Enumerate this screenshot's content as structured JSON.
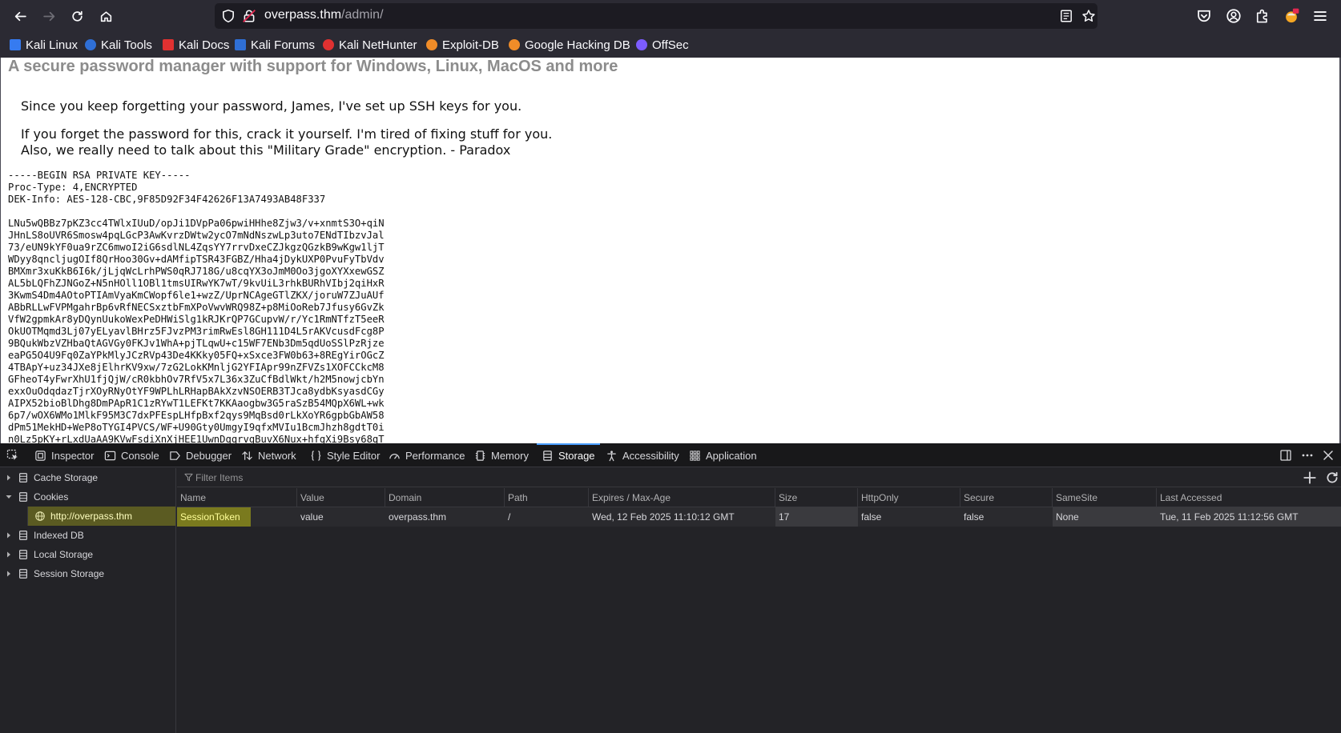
{
  "browser": {
    "url_host": "overpass.thm",
    "url_path": "/admin/"
  },
  "bookmarks": [
    {
      "label": "Kali Linux",
      "color": "#367bf0"
    },
    {
      "label": "Kali Tools",
      "color": "#2f6fd6"
    },
    {
      "label": "Kali Docs",
      "color": "#e03131"
    },
    {
      "label": "Kali Forums",
      "color": "#2f6fd6"
    },
    {
      "label": "Kali NetHunter",
      "color": "#e03131"
    },
    {
      "label": "Exploit-DB",
      "color": "#f08c28"
    },
    {
      "label": "Google Hacking DB",
      "color": "#f08c28"
    },
    {
      "label": "OffSec",
      "color": "#7c5cff"
    }
  ],
  "page": {
    "subtitle": "A secure password manager with support for Windows, Linux, MacOS and more",
    "msg1": "Since you keep forgetting your password, James, I've set up SSH keys for you.",
    "msg2": "If you forget the password for this, crack it yourself. I'm tired of fixing stuff for you.",
    "msg3": "Also, we really need to talk about this \"Military Grade\" encryption. - Paradox",
    "key_header": "-----BEGIN RSA PRIVATE KEY-----\nProc-Type: 4,ENCRYPTED\nDEK-Info: AES-128-CBC,9F85D92F34F42626F13A7493AB48F337",
    "key_body": "LNu5wQBBz7pKZ3cc4TWlxIUuD/opJi1DVpPa06pwiHHhe8Zjw3/v+xnmtS3O+qiN\nJHnLS8oUVR6Smosw4pqLGcP3AwKvrzDWtw2ycO7mNdNszwLp3uto7ENdTIbzvJal\n73/eUN9kYF0ua9rZC6mwoI2iG6sdlNL4ZqsYY7rrvDxeCZJkgzQGzkB9wKgw1ljT\nWDyy8qncljugOIf8QrHoo30Gv+dAMfipTSR43FGBZ/Hha4jDykUXP0PvuFyTbVdv\nBMXmr3xuKkB6I6k/jLjqWcLrhPWS0qRJ718G/u8cqYX3oJmM0Oo3jgoXYXxewGSZ\nAL5bLQFhZJNGoZ+N5nHOll1OBl1tmsUIRwYK7wT/9kvUiL3rhkBURhVIbj2qiHxR\n3KwmS4Dm4AOtoPTIAmVyaKmCWopf6le1+wzZ/UprNCAgeGTlZKX/joruW7ZJuAUf\nABbRLLwFVPMgahrBp6vRfNECSxztbFmXPoVwvWRQ98Z+p8MiOoReb7Jfusy6GvZk\nVfW2gpmkAr8yDQynUukoWexPeDHWiSlg1kRJKrQP7GCupvW/r/Yc1RmNTfzT5eeR\nOkUOTMqmd3Lj07yELyavlBHrz5FJvzPM3rimRwEsl8GH111D4L5rAKVcusdFcg8P\n9BQukWbzVZHbaQtAGVGy0FKJv1WhA+pjTLqwU+c15WF7ENb3Dm5qdUoSSlPzRjze\neaPG5O4U9Fq0ZaYPkMlyJCzRVp43De4KKky05FQ+xSxce3FW0b63+8REgYirOGcZ\n4TBApY+uz34JXe8jElhrKV9xw/7zG2LokKMnljG2YFIApr99nZFVZs1XOFCCkcM8\nGFheoT4yFwrXhU1fjQjW/cR0kbhOv7RfV5x7L36x3ZuCfBdlWkt/h2M5nowjcbYn\nexxOuOdqdazTjrXOyRNyOtYF9WPLhLRHapBAkXzvNSOERB3TJca8ydbKsyasdCGy\nAIPX52bioBlDhg8DmPApR1C1zRYwT1LEFKt7KKAaogbw3G5raSzB54MQpX6WL+wk\n6p7/wOX6WMo1MlkF95M3C7dxPFEspLHfpBxf2qys9MqBsd0rLkXoYR6gpbGbAW58\ndPm51MekHD+WeP8oTYGI4PVCS/WF+U90Gty0UmgyI9qfxMVIu1BcmJhzh8gdtT0i\nn0Lz5pKY+rLxdUaAA9KVwFsdiXnXjHEE1UwnDqqrvgBuvX6Nux+hfgXi9Bsy68qT"
  },
  "devtools": {
    "tabs": [
      "Inspector",
      "Console",
      "Debugger",
      "Network",
      "Style Editor",
      "Performance",
      "Memory",
      "Storage",
      "Accessibility",
      "Application"
    ],
    "active_tab": "Storage",
    "tree": {
      "cache_storage": "Cache Storage",
      "cookies": "Cookies",
      "cookie_host": "http://overpass.thm",
      "indexed_db": "Indexed DB",
      "local_storage": "Local Storage",
      "session_storage": "Session Storage"
    },
    "filter_placeholder": "Filter Items",
    "columns": [
      "Name",
      "Value",
      "Domain",
      "Path",
      "Expires / Max-Age",
      "Size",
      "HttpOnly",
      "Secure",
      "SameSite",
      "Last Accessed"
    ],
    "row": [
      "SessionToken",
      "value",
      "overpass.thm",
      "/",
      "Wed, 12 Feb 2025 11:10:12 GMT",
      "17",
      "false",
      "false",
      "None",
      "Tue, 11 Feb 2025 11:12:56 GMT"
    ]
  }
}
